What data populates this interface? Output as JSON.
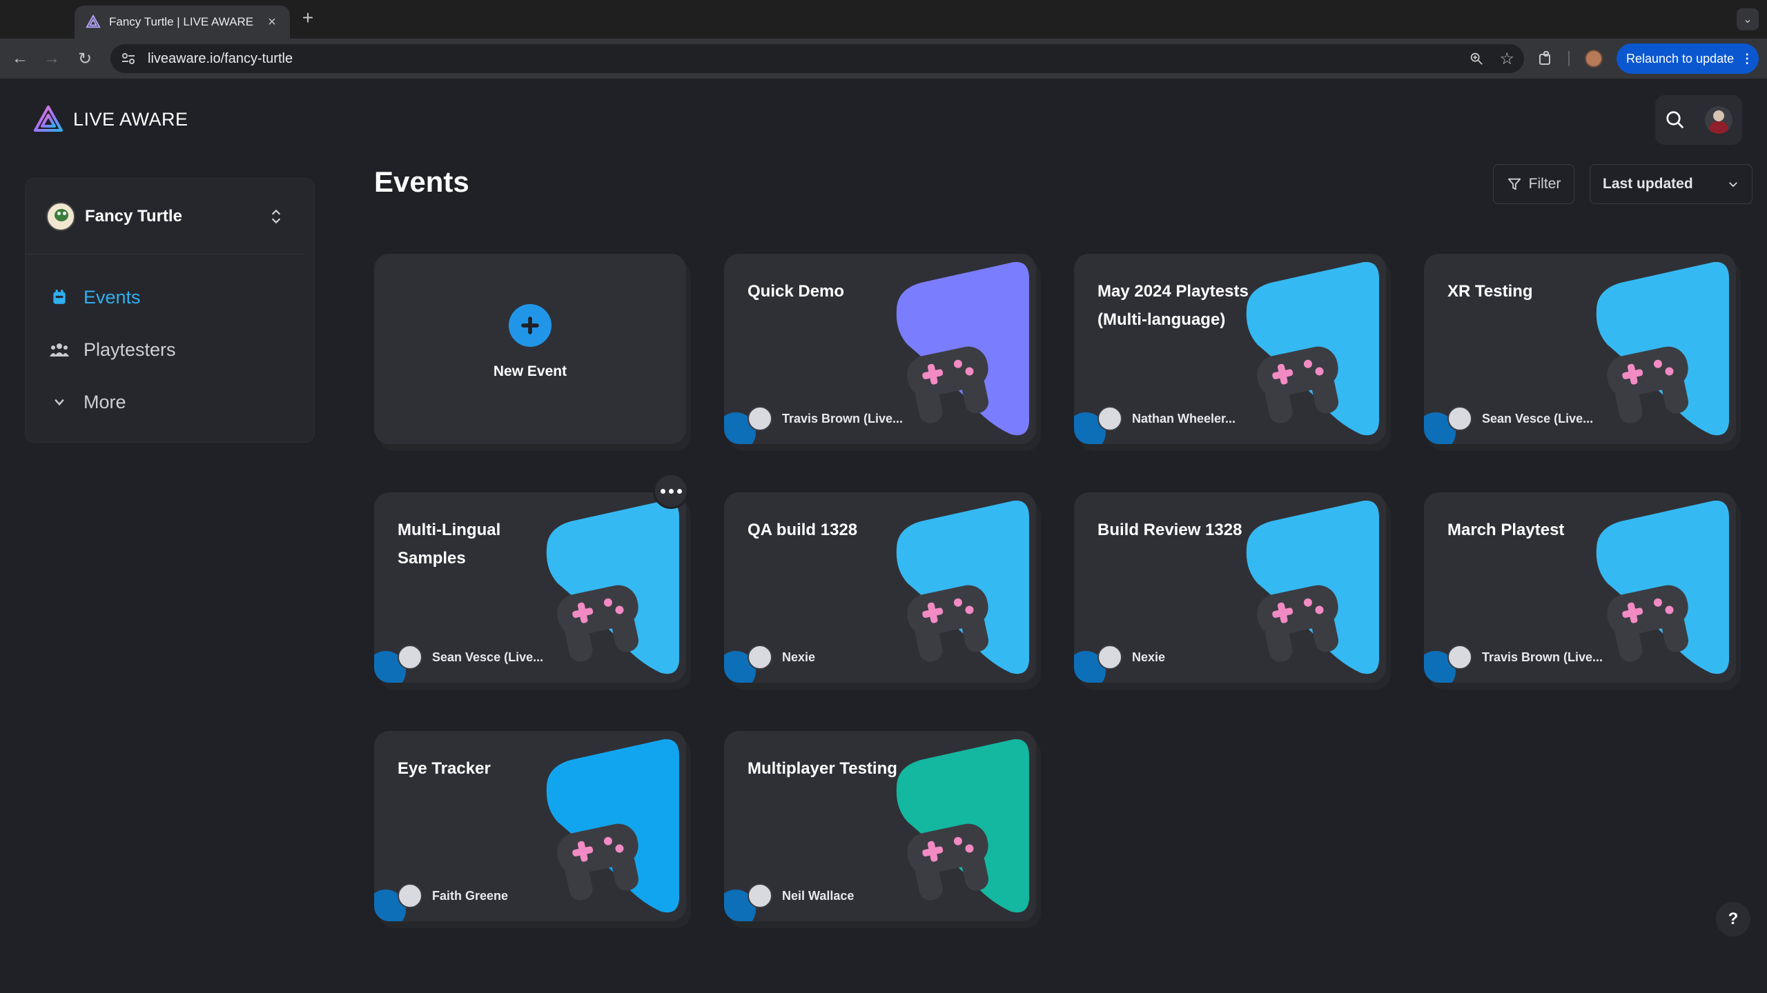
{
  "browser": {
    "tab_title": "Fancy Turtle | LIVE AWARE",
    "url": "liveaware.io/fancy-turtle",
    "relaunch_label": "Relaunch to update"
  },
  "app": {
    "brand": "LIVE AWARE",
    "workspace": "Fancy Turtle",
    "page_title": "Events",
    "filter_label": "Filter",
    "sort_label": "Last updated",
    "nav": [
      {
        "label": "Events"
      },
      {
        "label": "Playtesters"
      },
      {
        "label": "More"
      }
    ],
    "new_event_label": "New Event",
    "help_label": "?"
  },
  "events": [
    {
      "title": "Quick Demo",
      "owner": "Travis Brown (Live...",
      "color": "#7b7dff"
    },
    {
      "title": "May 2024 Playtests (Multi-language)",
      "owner": "Nathan Wheeler...",
      "color": "#35b9f2"
    },
    {
      "title": "XR Testing",
      "owner": "Sean Vesce (Live...",
      "color": "#35b9f2"
    },
    {
      "title": "Multi-Lingual Samples",
      "owner": "Sean Vesce (Live...",
      "color": "#35b9f2"
    },
    {
      "title": "QA build 1328",
      "owner": "Nexie",
      "color": "#35b9f2"
    },
    {
      "title": "Build Review 1328",
      "owner": "Nexie",
      "color": "#35b9f2"
    },
    {
      "title": "March Playtest",
      "owner": "Travis Brown (Live...",
      "color": "#35b9f2"
    },
    {
      "title": "Eye Tracker",
      "owner": "Faith Greene",
      "color": "#12a5ef"
    },
    {
      "title": "Multiplayer Testing",
      "owner": "Neil Wallace",
      "color": "#14b7a0"
    }
  ],
  "icons": {
    "controller_accent": "#f28bc4",
    "controller_body": "#3c3d43",
    "brand_gradient": [
      "#a073ff",
      "#2eb0f0"
    ]
  }
}
